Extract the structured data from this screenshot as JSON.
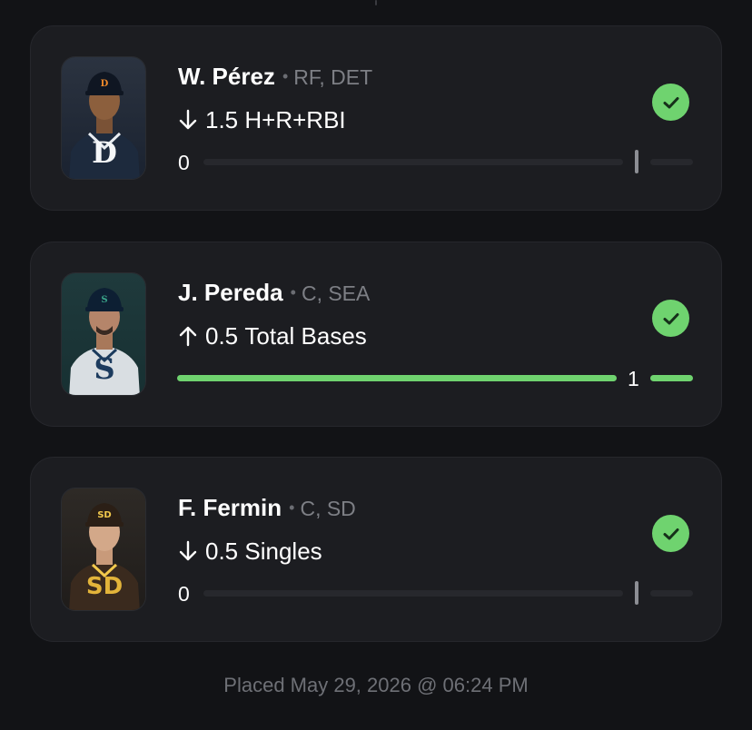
{
  "colors": {
    "background": "#121316",
    "card": "#1c1d21",
    "success": "#6fd36f",
    "muted_text": "#7d7f85",
    "track": "#27282d"
  },
  "legs": [
    {
      "player_name": "W. Pérez",
      "separator": "•",
      "position_team": "RF, DET",
      "direction": "under",
      "direction_icon": "arrow-down-icon",
      "line": "1.5",
      "stat": "H+R+RBI",
      "result": "0",
      "status_icon": "check-circle-icon",
      "team_logo_icon": "tigers-d-icon",
      "progress_fraction": 0
    },
    {
      "player_name": "J. Pereda",
      "separator": "•",
      "position_team": "C, SEA",
      "direction": "over",
      "direction_icon": "arrow-up-icon",
      "line": "0.5",
      "stat": "Total Bases",
      "result": "1",
      "status_icon": "check-circle-icon",
      "team_logo_icon": "mariners-s-icon",
      "progress_fraction": 1
    },
    {
      "player_name": "F. Fermin",
      "separator": "•",
      "position_team": "C, SD",
      "direction": "under",
      "direction_icon": "arrow-down-icon",
      "line": "0.5",
      "stat": "Singles",
      "result": "0",
      "status_icon": "check-circle-icon",
      "team_logo_icon": "padres-sd-icon",
      "progress_fraction": 0
    }
  ],
  "footer": {
    "placed_text": "Placed May 29, 2026 @ 06:24 PM"
  }
}
